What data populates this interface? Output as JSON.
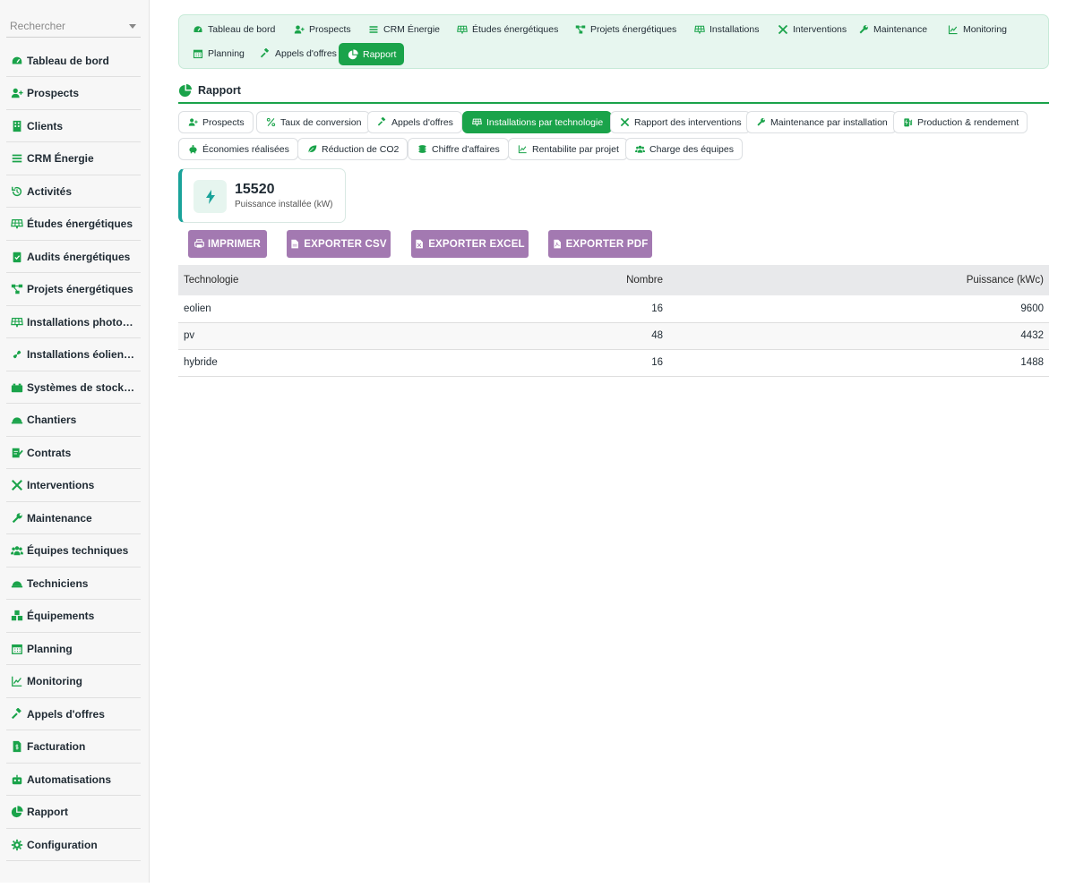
{
  "colors": {
    "accent": "#1aa34a",
    "export_button": "#a379b1",
    "nav_bg": "#e7f6ef"
  },
  "sidebar": {
    "search_placeholder": "Rechercher",
    "items": [
      {
        "label": "Tableau de bord",
        "icon": "gauge-icon"
      },
      {
        "label": "Prospects",
        "icon": "user-plus-icon"
      },
      {
        "label": "Clients",
        "icon": "building-icon"
      },
      {
        "label": "CRM Énergie",
        "icon": "list-icon"
      },
      {
        "label": "Activités",
        "icon": "history-icon"
      },
      {
        "label": "Études énergétiques",
        "icon": "solar-panel-icon"
      },
      {
        "label": "Audits énergétiques",
        "icon": "clipboard-check-icon"
      },
      {
        "label": "Projets énergétiques",
        "icon": "project-diagram-icon"
      },
      {
        "label": "Installations photov…",
        "icon": "solar-panel-icon"
      },
      {
        "label": "Installations éoliennes",
        "icon": "fan-icon"
      },
      {
        "label": "Systèmes de stockage",
        "icon": "battery-icon"
      },
      {
        "label": "Chantiers",
        "icon": "hard-hat-icon"
      },
      {
        "label": "Contrats",
        "icon": "signature-icon"
      },
      {
        "label": "Interventions",
        "icon": "tools-icon"
      },
      {
        "label": "Maintenance",
        "icon": "wrench-icon"
      },
      {
        "label": "Équipes techniques",
        "icon": "users-icon"
      },
      {
        "label": "Techniciens",
        "icon": "hard-hat-icon"
      },
      {
        "label": "Équipements",
        "icon": "boxes-icon"
      },
      {
        "label": "Planning",
        "icon": "calendar-icon"
      },
      {
        "label": "Monitoring",
        "icon": "chart-line-icon"
      },
      {
        "label": "Appels d'offres",
        "icon": "gavel-icon"
      },
      {
        "label": "Facturation",
        "icon": "invoice-icon"
      },
      {
        "label": "Automatisations",
        "icon": "robot-icon"
      },
      {
        "label": "Rapport",
        "icon": "chart-pie-icon"
      },
      {
        "label": "Configuration",
        "icon": "gear-icon"
      }
    ]
  },
  "topnav": [
    {
      "label": "Tableau de bord",
      "icon": "gauge-icon"
    },
    {
      "label": "Prospects",
      "icon": "user-plus-icon"
    },
    {
      "label": "CRM Énergie",
      "icon": "list-icon"
    },
    {
      "label": "Études énergétiques",
      "icon": "solar-panel-icon"
    },
    {
      "label": "Projets énergétiques",
      "icon": "project-diagram-icon"
    },
    {
      "label": "Installations",
      "icon": "solar-panel-icon"
    },
    {
      "label": "Interventions",
      "icon": "tools-icon"
    },
    {
      "label": "Maintenance",
      "icon": "wrench-icon"
    },
    {
      "label": "Monitoring",
      "icon": "chart-line-icon"
    },
    {
      "label": "Planning",
      "icon": "calendar-icon"
    },
    {
      "label": "Appels d'offres",
      "icon": "gavel-icon"
    },
    {
      "label": "Rapport",
      "icon": "chart-pie-icon",
      "active": true
    }
  ],
  "section": {
    "title": "Rapport",
    "icon": "chart-pie-icon"
  },
  "report_tabs": [
    {
      "label": "Prospects",
      "icon": "user-plus-icon"
    },
    {
      "label": "Taux de conversion",
      "icon": "percent-icon"
    },
    {
      "label": "Appels d'offres",
      "icon": "gavel-icon"
    },
    {
      "label": "Installations par technologie",
      "icon": "solar-panel-icon",
      "active": true
    },
    {
      "label": "Rapport des interventions",
      "icon": "tools-icon"
    },
    {
      "label": "Maintenance par installation",
      "icon": "wrench-icon"
    },
    {
      "label": "Production & rendement",
      "icon": "charging-station-icon"
    },
    {
      "label": "Économies réalisées",
      "icon": "piggy-bank-icon"
    },
    {
      "label": "Réduction de CO2",
      "icon": "leaf-icon"
    },
    {
      "label": "Chiffre d'affaires",
      "icon": "coins-icon"
    },
    {
      "label": "Rentabilite par projet",
      "icon": "chart-line-icon"
    },
    {
      "label": "Charge des équipes",
      "icon": "users-icon"
    }
  ],
  "stat": {
    "value": "15520",
    "caption": "Puissance installée (kW)",
    "icon": "bolt-icon"
  },
  "export_buttons": [
    {
      "label": "IMPRIMER",
      "icon": "print-icon"
    },
    {
      "label": "EXPORTER CSV",
      "icon": "file-csv-icon"
    },
    {
      "label": "EXPORTER EXCEL",
      "icon": "file-excel-icon"
    },
    {
      "label": "EXPORTER PDF",
      "icon": "file-pdf-icon"
    }
  ],
  "table": {
    "headers": [
      "Technologie",
      "Nombre",
      "Puissance (kWc)"
    ],
    "rows": [
      [
        "eolien",
        "16",
        "9600"
      ],
      [
        "pv",
        "48",
        "4432"
      ],
      [
        "hybride",
        "16",
        "1488"
      ]
    ]
  }
}
